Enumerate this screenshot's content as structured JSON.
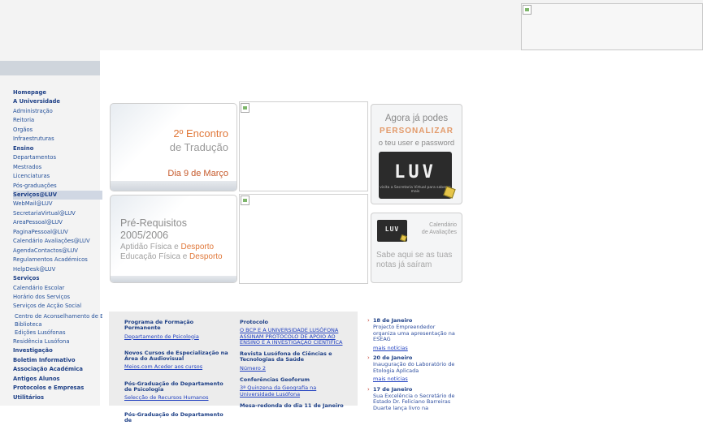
{
  "sidebar": {
    "items": [
      {
        "label": "Homepage",
        "type": "sec"
      },
      {
        "label": "A Universidade",
        "type": "sec"
      },
      {
        "label": "Administração",
        "type": "link"
      },
      {
        "label": "Reitoria",
        "type": "link"
      },
      {
        "label": "Orgãos",
        "type": "link"
      },
      {
        "label": "Infraestruturas",
        "type": "link"
      },
      {
        "label": "Ensino",
        "type": "sec"
      },
      {
        "label": "Departamentos",
        "type": "link"
      },
      {
        "label": "Mestrados",
        "type": "link"
      },
      {
        "label": "Licenciaturas",
        "type": "link"
      },
      {
        "label": "Pós-graduações",
        "type": "link"
      },
      {
        "label": "Serviços@LUV",
        "type": "sec-hl"
      },
      {
        "label": "WebMail@LUV",
        "type": "link"
      },
      {
        "label": "SecretariaVirtual@LUV",
        "type": "link"
      },
      {
        "label": "AreaPessoal@LUV",
        "type": "link"
      },
      {
        "label": "PaginaPessoal@LUV",
        "type": "link"
      },
      {
        "label": "Calendário Avaliações@LUV",
        "type": "link"
      },
      {
        "label": "AgendaContactos@LUV",
        "type": "link"
      },
      {
        "label": "Regulamentos Académicos",
        "type": "link"
      },
      {
        "label": "HelpDesk@LUV",
        "type": "link"
      },
      {
        "label": "Serviços",
        "type": "sec"
      },
      {
        "label": "Calendário Escolar",
        "type": "link"
      },
      {
        "label": "Horário dos Serviços",
        "type": "link"
      },
      {
        "label": "Serviços de Acção Social",
        "type": "link"
      },
      {
        "label": "Centro de Aconselhamento de Estudantes",
        "type": "sub"
      },
      {
        "label": "Biblioteca",
        "type": "sub"
      },
      {
        "label": "Edições Lusófonas",
        "type": "sub"
      },
      {
        "label": "Residência Lusófona",
        "type": "link"
      },
      {
        "label": "Investigação",
        "type": "sec"
      },
      {
        "label": "Boletim Informativo",
        "type": "sec"
      },
      {
        "label": "Associação Académica",
        "type": "sec"
      },
      {
        "label": "Antigos Alunos",
        "type": "sec"
      },
      {
        "label": "Protocolos e Empresas",
        "type": "sec"
      },
      {
        "label": "Utilitários",
        "type": "sec"
      }
    ]
  },
  "banners": {
    "encontro": {
      "line1": "2º Encontro",
      "line2": "de Tradução",
      "date": "Dia 9 de Março"
    },
    "prerequisitos": {
      "line1": "Pré-Requisitos",
      "line2": "2005/2006",
      "line3a": "Aptidão Física e ",
      "line3b": "Desporto",
      "line4a": "Educação Física e ",
      "line4b": "Desporto"
    },
    "luv_personalizar": {
      "line1": "Agora já podes",
      "line2": "PERSONALIZAR",
      "line3": "o teu user e password",
      "logo": "LUV",
      "caption": "visita a Secretaria Virtual para saberes mais"
    },
    "luv_calendario": {
      "logo": "LUV",
      "cal1": "Calendário",
      "cal2": "de Avaliações",
      "q1": "Sabe aqui se as tuas",
      "q2": "notas já saíram"
    }
  },
  "news_col1": [
    {
      "title": "Programa de Formação Permanente",
      "link": "Departamento de Psicologia"
    },
    {
      "title": "Novos Cursos de Especialização na Área do Audiovisual",
      "link": "Meios.com Aceder aos cursos"
    },
    {
      "title": "Pós-Graduação do Departamento de Psicologia",
      "link": "Selecção de Recursos Humanos"
    },
    {
      "title": "Pós-Graduação do Departamento de",
      "link": ""
    }
  ],
  "news_col2": [
    {
      "title": "Protocolo",
      "link": "O BCP E A UNIVERSIDADE LUSÓFONA ASSINAM PROTOCOLO DE APOIO AO ENSINO E À INVESTIGAÇÃO CIENTÍFICA"
    },
    {
      "title": "Revista Lusófona de Ciências e Tecnologias da Saúde",
      "link": "Número 2"
    },
    {
      "title": "Conferências Geoforum",
      "link": "3ª Quinzena da Geografia na Universidade Lusófona"
    },
    {
      "title": "Mesa-redonda do dia 11 de Janeiro",
      "link": ""
    }
  ],
  "events": [
    {
      "date": "18 de Janeiro",
      "text": "Projecto Empreendedor organiza uma apresentação na ESEAG",
      "more": "mais notícias"
    },
    {
      "date": "20 de Janeiro",
      "text": "Inauguração do Laboratório de Etologia Aplicada",
      "more": "mais notícias"
    },
    {
      "date": "17 de Janeiro",
      "text": "Sua Excelência o Secretário de Estado Dr. Feliciano Barreiras Duarte lança livro na",
      "more": ""
    }
  ]
}
